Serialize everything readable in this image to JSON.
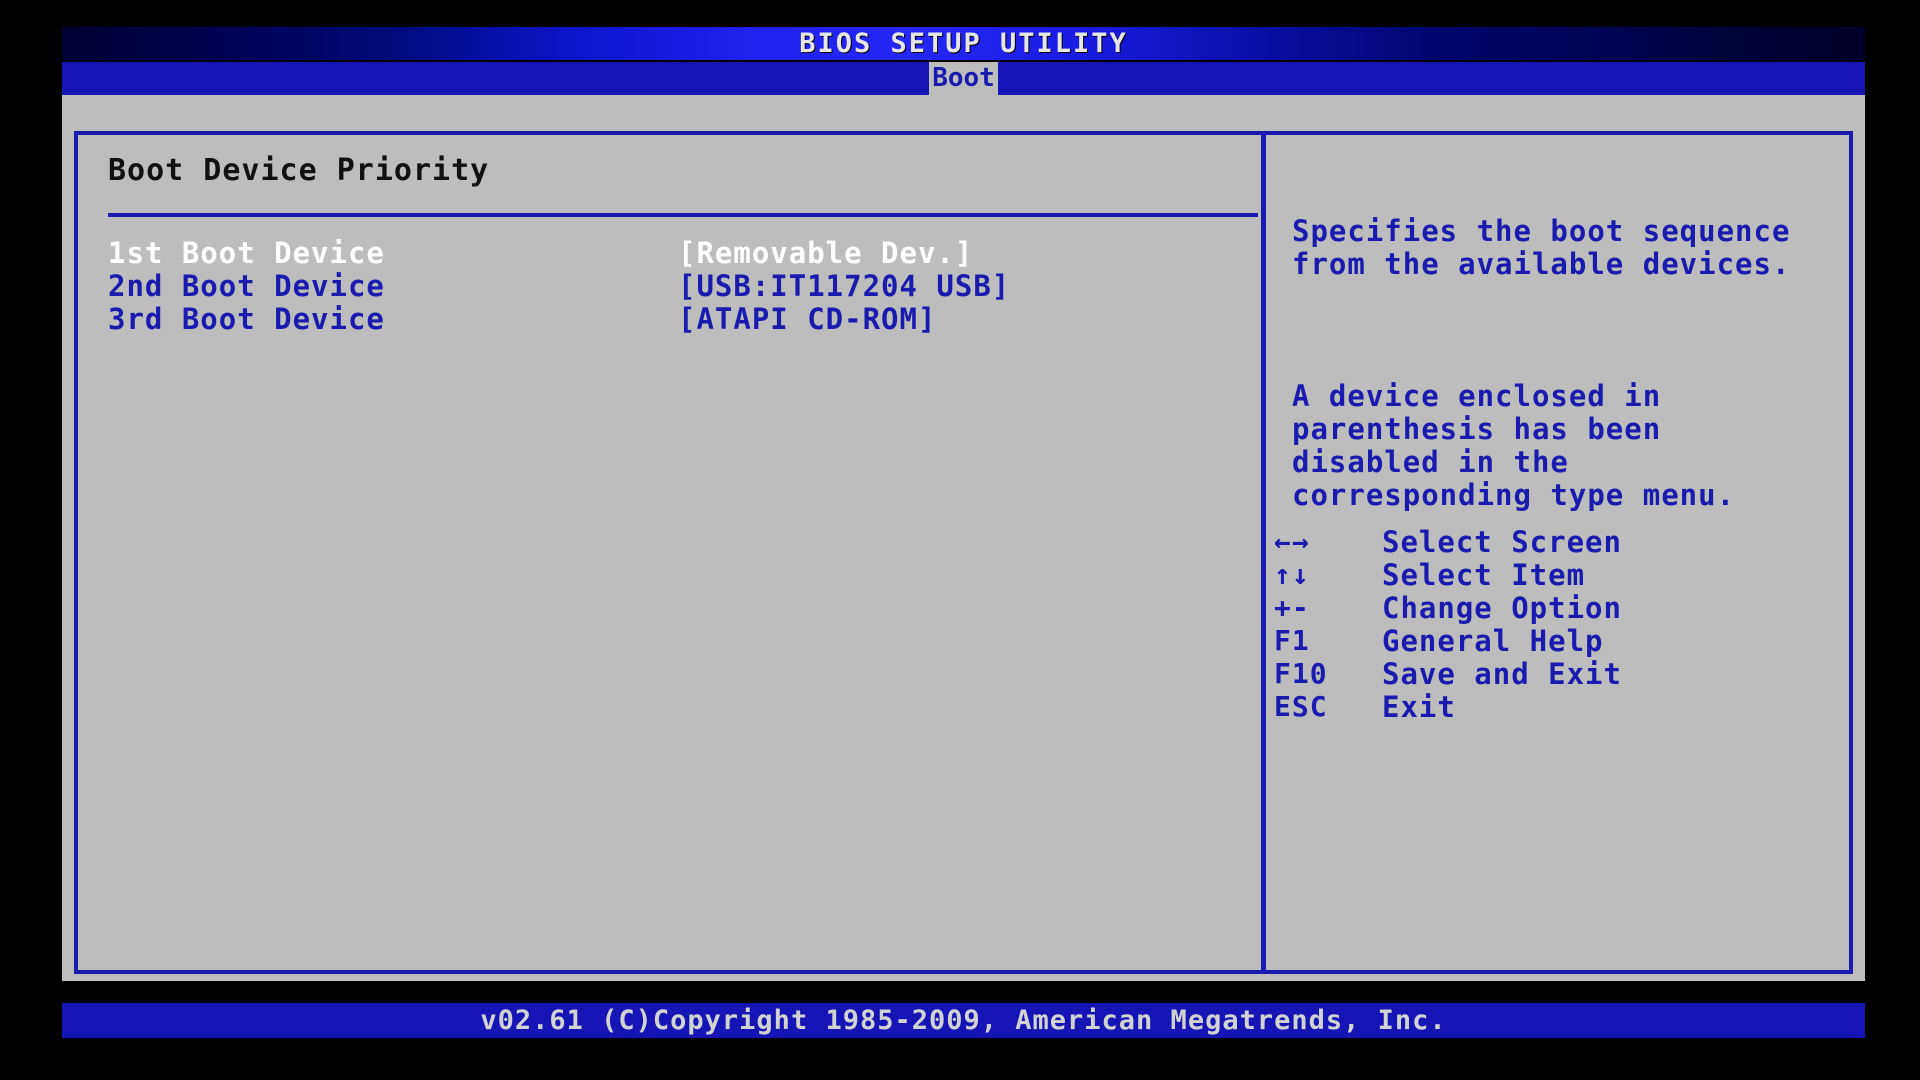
{
  "window": {
    "title": "BIOS SETUP UTILITY"
  },
  "menu": {
    "active_tab": "Boot",
    "tabs": [
      "Boot"
    ]
  },
  "colors": {
    "accent_blue": "#1a1aaf",
    "bar_blue": "#1515b5",
    "panel_gray": "#bdbdbd",
    "selected_text": "#ffffff",
    "title_text": "#e6e6e6",
    "heading_text": "#111111"
  },
  "main": {
    "section_title": "Boot Device Priority",
    "boot_devices": [
      {
        "label": "1st Boot Device",
        "value": "[Removable Dev.]",
        "selected": true
      },
      {
        "label": "2nd Boot Device",
        "value": "[USB:IT117204 USB]",
        "selected": false
      },
      {
        "label": "3rd Boot Device",
        "value": "[ATAPI CD-ROM]",
        "selected": false
      }
    ]
  },
  "help": {
    "paragraphs": [
      "Specifies the boot sequence from the available devices.",
      "A device enclosed in parenthesis has been disabled in the corresponding type menu."
    ],
    "paragraph_1": "Specifies the boot sequence from the available devices.",
    "paragraph_2": "A device enclosed in parenthesis has been disabled in the corresponding type menu."
  },
  "key_legend": [
    {
      "key": "←→",
      "desc": "Select Screen",
      "icon": "left-right-arrow-icon"
    },
    {
      "key": "↑↓",
      "desc": "Select Item",
      "icon": "up-down-arrow-icon"
    },
    {
      "key": "+-",
      "desc": "Change Option",
      "icon": "plus-minus-icon"
    },
    {
      "key": "F1",
      "desc": "General Help",
      "icon": "f1-key-icon"
    },
    {
      "key": "F10",
      "desc": "Save and Exit",
      "icon": "f10-key-icon"
    },
    {
      "key": "ESC",
      "desc": "Exit",
      "icon": "esc-key-icon"
    }
  ],
  "footer": {
    "text": "v02.61 (C)Copyright 1985-2009, American Megatrends, Inc."
  }
}
